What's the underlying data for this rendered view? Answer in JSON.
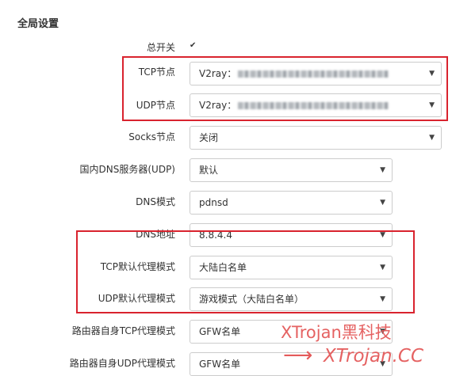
{
  "section_title": "全局设置",
  "fields": {
    "main_switch": {
      "label": "总开关",
      "checked": true
    },
    "tcp_node": {
      "label": "TCP节点",
      "value": "V2ray："
    },
    "udp_node": {
      "label": "UDP节点",
      "value": "V2ray："
    },
    "socks_node": {
      "label": "Socks节点",
      "value": "关闭"
    },
    "dns_server": {
      "label": "国内DNS服务器(UDP)",
      "value": "默认"
    },
    "dns_mode": {
      "label": "DNS模式",
      "value": "pdnsd"
    },
    "dns_addr": {
      "label": "DNS地址",
      "value": "8.8.4.4"
    },
    "tcp_proxy_mode": {
      "label": "TCP默认代理模式",
      "value": "大陆白名单"
    },
    "udp_proxy_mode": {
      "label": "UDP默认代理模式",
      "value": "游戏模式（大陆白名单）"
    },
    "router_tcp_mode": {
      "label": "路由器自身TCP代理模式",
      "value": "GFW名单"
    },
    "router_udp_mode": {
      "label": "路由器自身UDP代理模式",
      "value": "GFW名单"
    }
  },
  "watermark": {
    "line1": "XTrojan黑科技",
    "line2": "XTrojan.CC",
    "arrow": "⟶"
  },
  "icons": {
    "dropdown": "▼",
    "check": "✔"
  },
  "colors": {
    "highlight": "#d9232e",
    "watermark": "#e45a5a"
  }
}
